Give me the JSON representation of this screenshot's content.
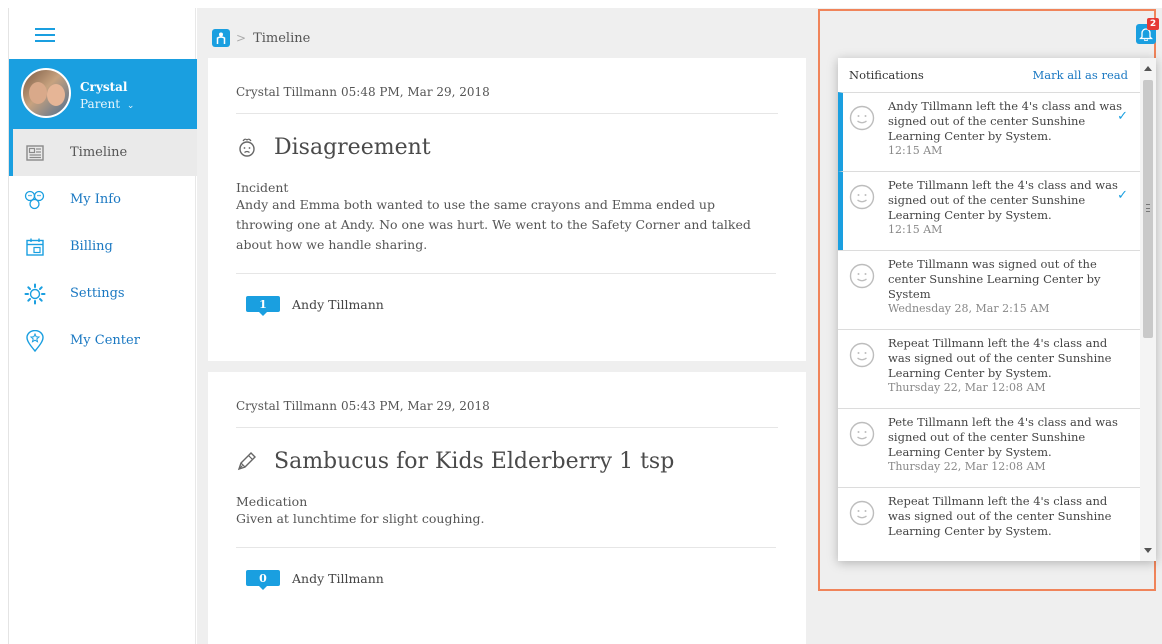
{
  "sidebar": {
    "user": {
      "name": "Crystal",
      "role": "Parent"
    },
    "items": [
      {
        "label": "Timeline",
        "icon": "newspaper-icon",
        "active": true
      },
      {
        "label": "My Info",
        "icon": "family-icon",
        "active": false
      },
      {
        "label": "Billing",
        "icon": "calendar-icon",
        "active": false
      },
      {
        "label": "Settings",
        "icon": "gear-icon",
        "active": false
      },
      {
        "label": "My Center",
        "icon": "center-badge-icon",
        "active": false
      }
    ]
  },
  "breadcrumb": {
    "current": "Timeline"
  },
  "cards": [
    {
      "author": "Crystal Tillmann",
      "timestamp": "05:48 PM, Mar 29, 2018",
      "title": "Disagreement",
      "icon": "incident-face-icon",
      "type": "Incident",
      "description": "Andy and Emma both wanted to use the same crayons and Emma ended up throwing one at Andy. No one was hurt. We went to the Safety Corner and talked about how we handle sharing.",
      "count": "1",
      "child": "Andy Tillmann"
    },
    {
      "author": "Crystal Tillmann",
      "timestamp": "05:43 PM, Mar 29, 2018",
      "title": "Sambucus for Kids Elderberry 1 tsp",
      "icon": "pen-icon",
      "type": "Medication",
      "description": "Given at lunchtime for slight coughing.",
      "count": "0",
      "child": "Andy Tillmann"
    }
  ],
  "notifications": {
    "badge_count": "2",
    "title": "Notifications",
    "mark_all_label": "Mark all as read",
    "items": [
      {
        "text": "Andy Tillmann left the 4's class and was signed out of the center Sunshine Learning Center by System.",
        "time": "12:15 AM",
        "unread": true
      },
      {
        "text": "Pete Tillmann left the 4's class and was signed out of the center Sunshine Learning Center by System.",
        "time": "12:15 AM",
        "unread": true
      },
      {
        "text": "Pete Tillmann was signed out of the center Sunshine Learning Center by System",
        "time": "Wednesday 28, Mar 2:15 AM",
        "unread": false
      },
      {
        "text": "Repeat Tillmann left the 4's class and was signed out of the center Sunshine Learning Center by System.",
        "time": "Thursday 22, Mar 12:08 AM",
        "unread": false
      },
      {
        "text": "Pete Tillmann left the 4's class and was signed out of the center Sunshine Learning Center by System.",
        "time": "Thursday 22, Mar 12:08 AM",
        "unread": false
      },
      {
        "text": "Repeat Tillmann left the 4's class and was signed out of the center Sunshine Learning Center by System.",
        "time": "",
        "unread": false
      }
    ]
  },
  "colors": {
    "accent": "#1a9fe0",
    "link": "#1a78c2",
    "highlight_border": "#f0845a",
    "badge": "#e53935"
  }
}
